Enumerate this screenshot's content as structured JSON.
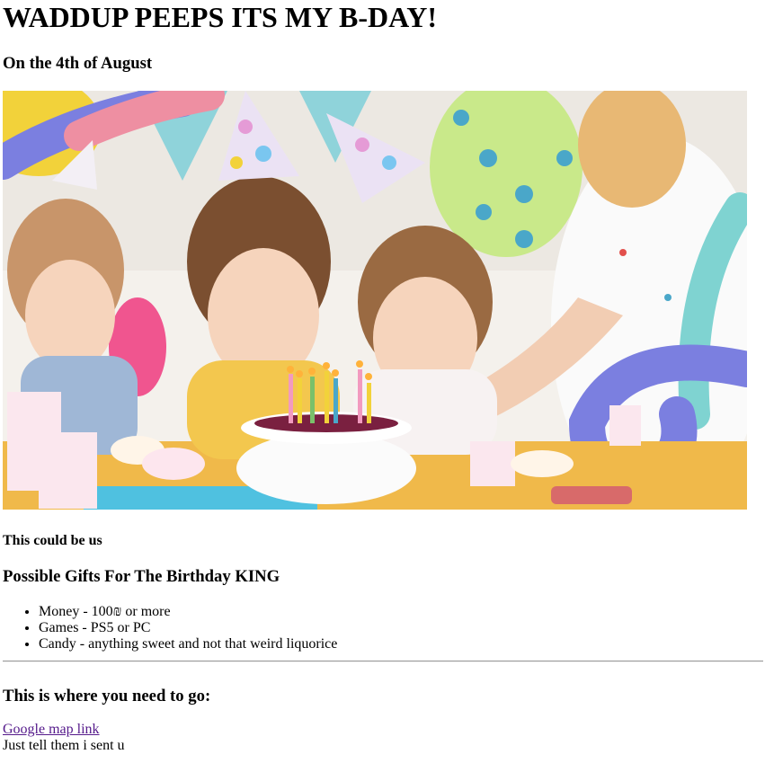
{
  "page": {
    "title": "WADDUP PEEPS ITS MY B-DAY!",
    "date_line": "On the 4th of August",
    "caption": "This could be us",
    "gifts_heading": "Possible Gifts For The Birthday KING",
    "gifts": [
      "Money - 100₪ or more",
      "Games - PS5 or PC",
      "Candy - anything sweet and not that weird liquorice"
    ],
    "location_heading": "This is where you need to go:",
    "map_link_text": "Google map link",
    "note": "Just tell them i sent u"
  },
  "image": {
    "subject": "three girls in party hats smiling at a birthday cake with candles",
    "colors": {
      "background": "#f4f1ec",
      "yellow_balloon": "#f2d23a",
      "green_balloon": "#c9e98a",
      "purple_swirl": "#7b7fe0",
      "teal_swirl": "#7fd3d1",
      "pink_swirl": "#ee8fa2",
      "table": "#f0b94a"
    }
  },
  "colors": {
    "text": "#000000",
    "link_visited": "#551a8b",
    "rule": "#9a9a9a"
  }
}
